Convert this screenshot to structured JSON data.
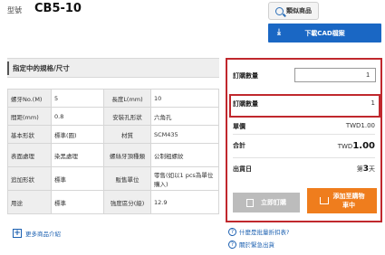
{
  "header": {
    "model_label": "型號",
    "model_code": "CB5-10",
    "similar_label": "類似商品",
    "cad_label": "下載CAD檔案"
  },
  "spec": {
    "title": "指定中的規格/尺寸",
    "rows": [
      {
        "k1": "螺牙No.(M)",
        "v1": "5",
        "k2": "長度L(mm)",
        "v2": "10"
      },
      {
        "k1": "間距(mm)",
        "v1": "0.8",
        "k2": "安裝孔形狀",
        "v2": "六角孔"
      },
      {
        "k1": "基本形狀",
        "v1": "標準(圓)",
        "k2": "材質",
        "v2": "SCM435"
      },
      {
        "k1": "表面處理",
        "v1": "染黑處理",
        "k2": "螺絲牙頂種類",
        "v2": "公制粗螺紋"
      },
      {
        "k1": "追加形狀",
        "v1": "標準",
        "k2": "販售單位",
        "v2": "零售(如以1 pcs為單位購入)"
      },
      {
        "k1": "用途",
        "v1": "標準",
        "k2": "強度區分(級)",
        "v2": "12.9"
      }
    ],
    "more_label": "更多商品介紹"
  },
  "order": {
    "qty_label": "訂購數量",
    "qty_value": "1",
    "qty2_label": "訂購數量",
    "qty2_value": "1",
    "unit_price_label": "單價",
    "unit_price_value": "TWD1.00",
    "total_label": "合計",
    "total_currency": "TWD",
    "total_value": "1.00",
    "ship_label": "出貨日",
    "ship_prefix": "第",
    "ship_days": "3",
    "ship_suffix": "天",
    "order_now_label": "立即訂購",
    "cart_label_1": "添加至購物",
    "cart_label_2": "車中"
  },
  "links": {
    "discount": "什麼是批量折扣表?",
    "urgent": "關於緊急出貨"
  },
  "colors": {
    "primary_blue": "#1a67c4",
    "highlight_red": "#c0282d",
    "cart_orange": "#ef7d1d"
  }
}
